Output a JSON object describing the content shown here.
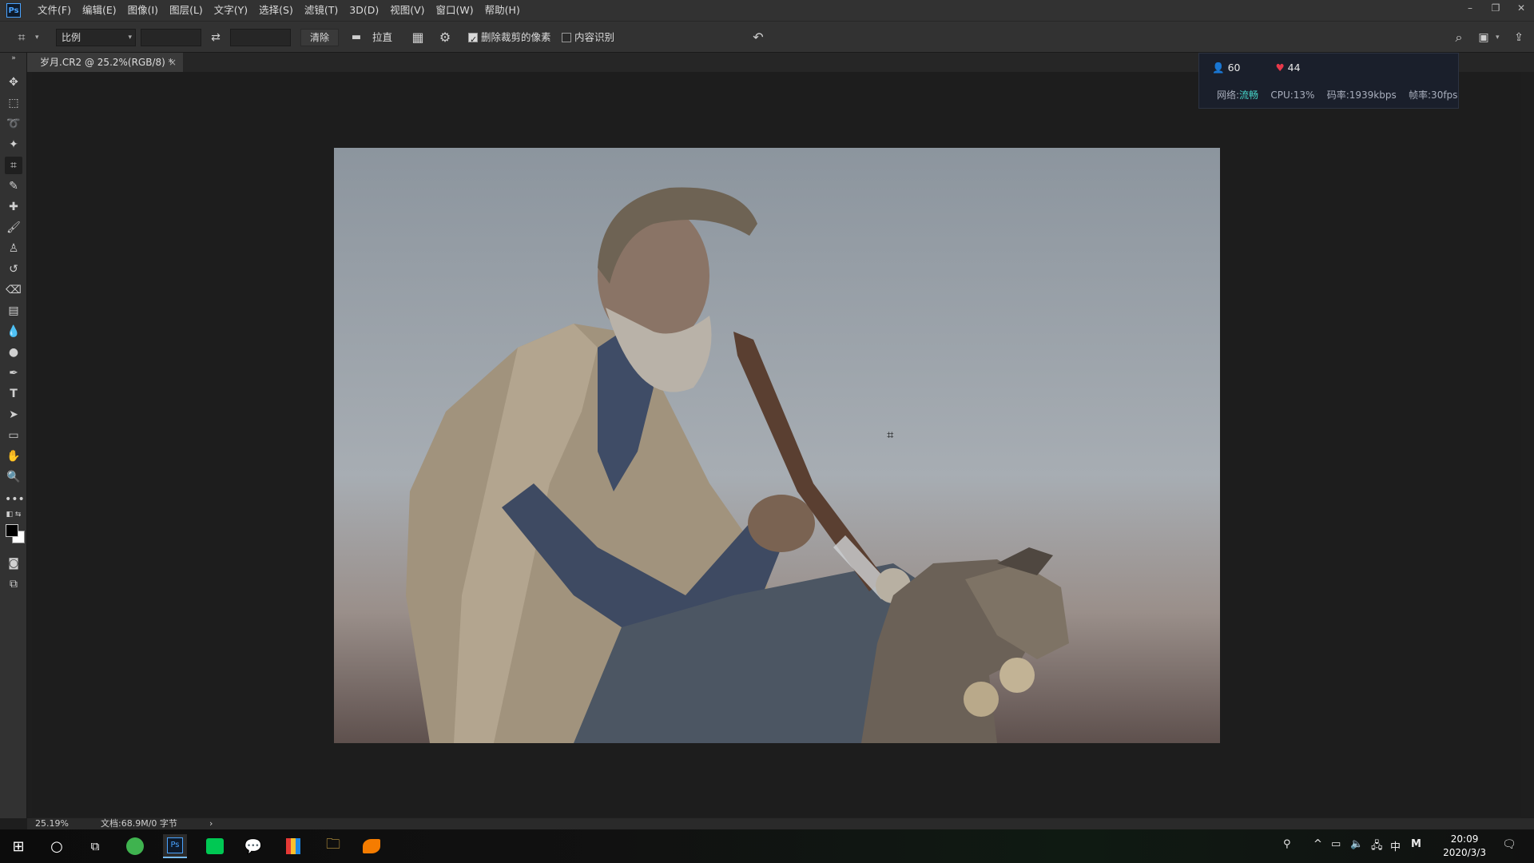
{
  "app": {
    "logo_text": "Ps"
  },
  "menu": [
    "文件(F)",
    "编辑(E)",
    "图像(I)",
    "图层(L)",
    "文字(Y)",
    "选择(S)",
    "滤镜(T)",
    "3D(D)",
    "视图(V)",
    "窗口(W)",
    "帮助(H)"
  ],
  "window_controls": {
    "minimize": "–",
    "restore": "❐",
    "close": "✕"
  },
  "options": {
    "ratio_select": "比例",
    "width_value": "",
    "height_value": "",
    "clear_label": "清除",
    "straighten_label": "拉直",
    "delete_cropped_label": "删除裁剪的像素",
    "delete_cropped_checked": true,
    "content_aware_label": "内容识别",
    "content_aware_checked": false
  },
  "document": {
    "tab_title": "岁月.CR2 @ 25.2%(RGB/8) *",
    "close": "×"
  },
  "status": {
    "zoom": "25.19%",
    "doc_info": "文档:68.9M/0 字节",
    "arrow": "›"
  },
  "stats_overlay": {
    "viewers": "60",
    "likes": "44",
    "network_label": "网络:",
    "network_value": "流畅",
    "cpu": "CPU:13%",
    "bitrate": "码率:1939kbps",
    "framerate": "帧率:30fps"
  },
  "taskbar": {
    "time": "20:09",
    "date": "2020/3/3",
    "ime": "中",
    "ime2": "M"
  },
  "colors": {
    "accent": "#4aa3ff",
    "ok": "#46d4c8",
    "heart": "#e8394a"
  }
}
